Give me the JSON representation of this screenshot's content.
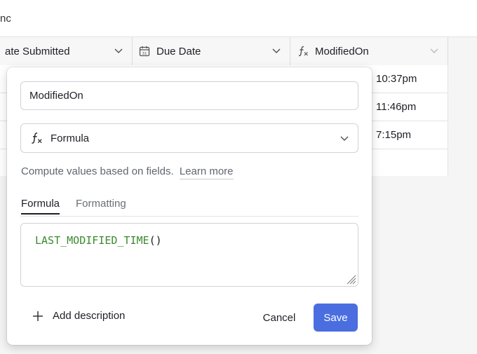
{
  "topbar": {
    "text": "nc"
  },
  "grid": {
    "columns": [
      {
        "label": "ate Submitted",
        "icon": ""
      },
      {
        "label": "Due Date",
        "icon": "calendar-icon"
      },
      {
        "label": "ModifiedOn",
        "icon": "formula-icon"
      }
    ],
    "rows": [
      {
        "modified": "10:37pm"
      },
      {
        "modified": "11:46pm"
      },
      {
        "modified": "7:15pm"
      }
    ]
  },
  "panel": {
    "field_name": "ModifiedOn",
    "field_type": "Formula",
    "help_text": "Compute values based on fields.",
    "learn_more": "Learn more",
    "tabs": {
      "formula": "Formula",
      "formatting": "Formatting"
    },
    "formula": {
      "function": "LAST_MODIFIED_TIME",
      "parens": "()"
    },
    "add_description": "Add description",
    "cancel": "Cancel",
    "save": "Save"
  },
  "colors": {
    "accent": "#4a6ee0",
    "formula_text": "#3a8a2e"
  }
}
